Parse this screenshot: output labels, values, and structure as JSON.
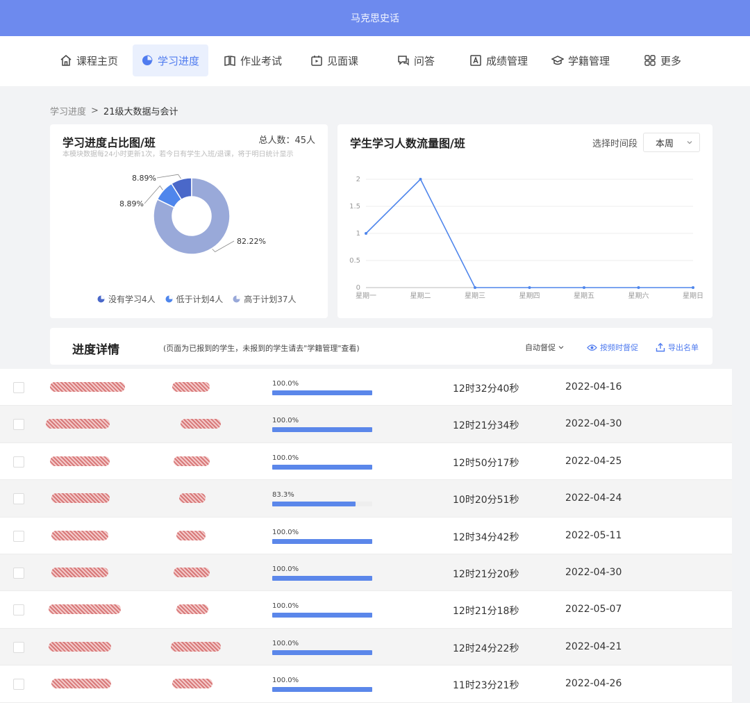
{
  "topbar": {
    "title": "马克思史话"
  },
  "nav": {
    "items": [
      {
        "label": "课程主页",
        "icon": "home-icon",
        "active": false
      },
      {
        "label": "学习进度",
        "icon": "pie-icon",
        "active": true
      },
      {
        "label": "作业考试",
        "icon": "book-icon",
        "active": false
      },
      {
        "label": "见面课",
        "icon": "video-icon",
        "active": false
      },
      {
        "label": "问答",
        "icon": "qa-icon",
        "active": false
      },
      {
        "label": "成绩管理",
        "icon": "grade-icon",
        "active": false
      },
      {
        "label": "学籍管理",
        "icon": "cap-icon",
        "active": false
      },
      {
        "label": "更多",
        "icon": "grid-icon",
        "active": false
      }
    ]
  },
  "breadcrumb": {
    "parent": "学习进度",
    "sep": ">",
    "current": "21级大数据与会计"
  },
  "pie_card": {
    "title": "学习进度占比图/班",
    "total": "总人数：45人",
    "note": "本模块数据每24小时更新1次，若今日有学生入班/退课，将于明日统计显示",
    "labels": [
      "8.89%",
      "8.89%",
      "82.22%"
    ],
    "legend": [
      "没有学习4人",
      "低于计划4人",
      "高于计划37人"
    ]
  },
  "line_card": {
    "title": "学生学习人数流量图/班",
    "time_label": "选择时间段",
    "time_value": "本周"
  },
  "chart_data": [
    {
      "type": "pie",
      "categories": [
        "没有学习",
        "低于计划",
        "高于计划"
      ],
      "values": [
        4,
        4,
        37
      ],
      "percent_labels": [
        "8.89%",
        "8.89%",
        "82.22%"
      ],
      "colors": [
        "#4a68c9",
        "#4f86ec",
        "#99a9d9"
      ],
      "title": "学习进度占比图/班",
      "legend": "bottom"
    },
    {
      "type": "line",
      "title": "学生学习人数流量图/班",
      "categories": [
        "星期一",
        "星期二",
        "星期三",
        "星期四",
        "星期五",
        "星期六",
        "星期日"
      ],
      "values": [
        1,
        2,
        0,
        0,
        0,
        0,
        0
      ],
      "yticks": [
        "0",
        "0.5",
        "1",
        "1.5",
        "2"
      ],
      "ylim": [
        0,
        2
      ],
      "grid": true,
      "color": "#4f86ec"
    }
  ],
  "detail": {
    "title": "进度详情",
    "note": "(页面为已报到的学生，未报到的学生请去\"学籍管理\"查看)",
    "sort": "自动督促",
    "reminder": "按频时督促",
    "export": "导出名单"
  },
  "rows": [
    {
      "progress": "100.0%",
      "progress_value": 1.0,
      "duration": "12时32分40秒",
      "date": "2022-04-16"
    },
    {
      "progress": "100.0%",
      "progress_value": 1.0,
      "duration": "12时21分34秒",
      "date": "2022-04-30"
    },
    {
      "progress": "100.0%",
      "progress_value": 1.0,
      "duration": "12时50分17秒",
      "date": "2022-04-25"
    },
    {
      "progress": "83.3%",
      "progress_value": 0.833,
      "duration": "10时20分51秒",
      "date": "2022-04-24"
    },
    {
      "progress": "100.0%",
      "progress_value": 1.0,
      "duration": "12时34分42秒",
      "date": "2022-05-11"
    },
    {
      "progress": "100.0%",
      "progress_value": 1.0,
      "duration": "12时21分20秒",
      "date": "2022-04-30"
    },
    {
      "progress": "100.0%",
      "progress_value": 1.0,
      "duration": "12时21分18秒",
      "date": "2022-05-07"
    },
    {
      "progress": "100.0%",
      "progress_value": 1.0,
      "duration": "12时24分22秒",
      "date": "2022-04-21"
    },
    {
      "progress": "100.0%",
      "progress_value": 1.0,
      "duration": "11时23分21秒",
      "date": "2022-04-26"
    }
  ]
}
